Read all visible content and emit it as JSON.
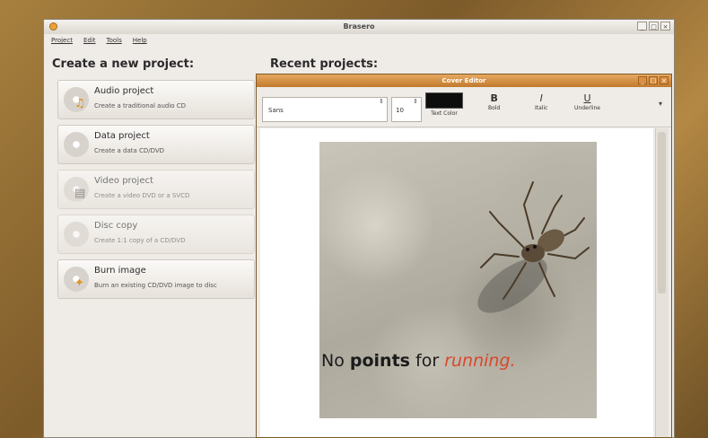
{
  "main_window": {
    "title": "Brasero",
    "controls": [
      "_",
      "□",
      "×"
    ],
    "menu": [
      "Project",
      "Edit",
      "Tools",
      "Help"
    ]
  },
  "create_heading": "Create a new project:",
  "recent_heading": "Recent projects:",
  "projects": [
    {
      "title": "Audio project",
      "desc": "Create a traditional audio CD",
      "icon": "audio-project-icon",
      "badge": "♫",
      "badge_color": "#e08a1e"
    },
    {
      "title": "Data project",
      "desc": "Create a data CD/DVD",
      "icon": "data-project-icon",
      "badge": "",
      "badge_color": "#888888"
    },
    {
      "title": "Video project",
      "desc": "Create a video DVD or a SVCD",
      "icon": "video-project-icon",
      "badge": "▤",
      "badge_color": "#555555"
    },
    {
      "title": "Disc copy",
      "desc": "Create 1:1 copy of a CD/DVD",
      "icon": "disc-copy-icon",
      "badge": "",
      "badge_color": "#888888"
    },
    {
      "title": "Burn image",
      "desc": "Burn an existing CD/DVD image to disc",
      "icon": "burn-image-icon",
      "badge": "✦",
      "badge_color": "#e0942a"
    }
  ],
  "cover_editor": {
    "title": "Cover Editor",
    "controls": [
      "_",
      "□",
      "×"
    ],
    "font": "Sans",
    "size": "10",
    "spin": "⇕",
    "text_color_label": "Text Color",
    "text_color": "#0d0d0d",
    "bold_label": "Bold",
    "italic_label": "Italic",
    "underline_label": "Underline",
    "bold_glyph": "B",
    "italic_glyph": "I",
    "underline_glyph": "U",
    "more": "▾",
    "caption_regular": "No ",
    "caption_bold": "points",
    "caption_mid": " for ",
    "caption_italic": "running."
  }
}
